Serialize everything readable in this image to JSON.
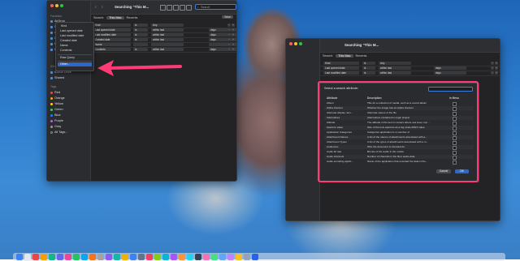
{
  "finder1": {
    "title": "Searching “This M...",
    "search_placeholder": "Search",
    "scope": [
      "Search:",
      "This Mac",
      "Recents"
    ],
    "save_label": "Save",
    "sidebar": {
      "favorites_header": "Favorites",
      "items": [
        "AirDrop",
        "Recents",
        "Applications",
        "Desktop",
        "Documents",
        "Downloads"
      ],
      "icloud_header": "iCloud",
      "icloud_items": [
        "iCloud Drive",
        "Shared"
      ],
      "tags_header": "Tags",
      "tags": [
        {
          "label": "Red",
          "color": "#ff453a"
        },
        {
          "label": "Orange",
          "color": "#ff9f0a"
        },
        {
          "label": "Yellow",
          "color": "#ffd60a"
        },
        {
          "label": "Green",
          "color": "#32d74b"
        },
        {
          "label": "Blue",
          "color": "#0a84ff"
        },
        {
          "label": "Purple",
          "color": "#bf5af2"
        },
        {
          "label": "Gray",
          "color": "#98989d"
        },
        {
          "label": "All Tags...",
          "color": ""
        }
      ]
    },
    "rows": [
      {
        "a": "Kind",
        "b": "is",
        "c": "Any"
      },
      {
        "a": "Last opened date",
        "b": "is",
        "c": "within last",
        "d": "days"
      },
      {
        "a": "Last modified date",
        "b": "is",
        "c": "within last",
        "d": "days"
      },
      {
        "a": "Created date",
        "b": "is",
        "c": "within last",
        "d": "days"
      },
      {
        "a": "Name",
        "b": "",
        "c": "",
        "d": ""
      },
      {
        "a": "Contents",
        "b": "is",
        "c": "within last",
        "d": "days"
      }
    ],
    "menu": {
      "items": [
        "Kind",
        "Last opened date",
        "Last modified date",
        "Created date",
        "Name",
        "Contents"
      ],
      "raw_query": "Raw Query",
      "other": "Other..."
    }
  },
  "finder2": {
    "title": "Searching “This M...",
    "scope": [
      "Search:",
      "This Mac",
      "Recents"
    ],
    "rows": [
      {
        "a": "Kind",
        "b": "is",
        "c": "Any"
      },
      {
        "a": "Last opened date",
        "b": "is",
        "c": "within last",
        "d": "days"
      },
      {
        "a": "Last modified date",
        "b": "is",
        "c": "within last",
        "d": "days"
      }
    ]
  },
  "dialog": {
    "title": "Select a search attribute:",
    "col_attribute": "Attribute",
    "col_description": "Description",
    "col_in_menu": "In Menu",
    "rows": [
      {
        "attr": "Album",
        "desc": "Title for a collection of media, such as a record album"
      },
      {
        "attr": "Alpha channel",
        "desc": "Whether the image has an Alpha channel"
      },
      {
        "attr": "Alternate display nam...",
        "desc": "Alternate names of the file"
      },
      {
        "attr": "Alternatives",
        "desc": "Alternatives contained in Logic project"
      },
      {
        "attr": "Altitude",
        "desc": "The altitude of the item in meters above sea level, exp..."
      },
      {
        "attr": "Aperture value",
        "desc": "Size of the lens aperture as a log-scale APEX value"
      },
      {
        "attr": "Application Categories",
        "desc": "Categories application is a member of"
      },
      {
        "attr": "Attachment Names",
        "desc": "A list of the names of attachments associated with a..."
      },
      {
        "attr": "Attachment Types",
        "desc": "A list of the types of attachments associated with a m..."
      },
      {
        "attr": "Audiences",
        "desc": "Who the document is intended for"
      },
      {
        "attr": "Audio bit rate",
        "desc": "Bit rate of the audio in the media"
      },
      {
        "attr": "Audio channels",
        "desc": "Number of channels in the file's audio data"
      },
      {
        "attr": "Audio encoding applic...",
        "desc": "Name of the application that encoded the data in the..."
      }
    ],
    "cancel": "Cancel",
    "ok": "OK"
  },
  "colors": {
    "accent": "#2c67c9",
    "highlight": "#ff3b76",
    "arrow": "#ff3b76"
  }
}
